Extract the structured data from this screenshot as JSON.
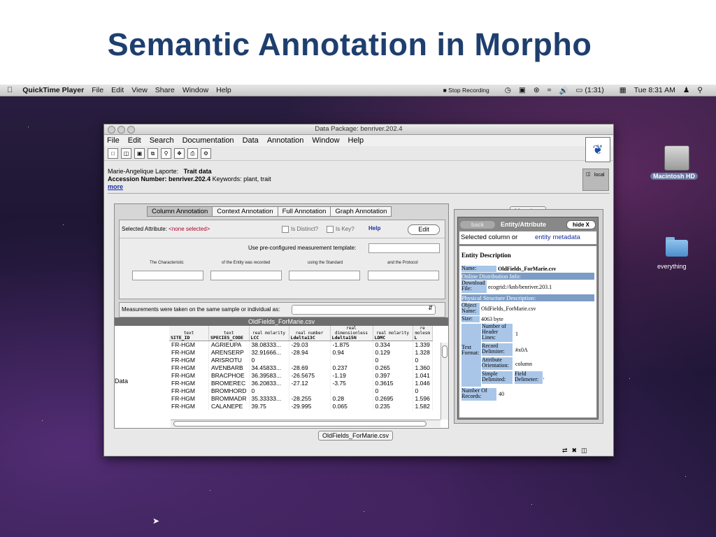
{
  "slide": {
    "title": "Semantic Annotation in Morpho"
  },
  "menubar": {
    "app": "QuickTime Player",
    "items": [
      "File",
      "Edit",
      "View",
      "Share",
      "Window",
      "Help"
    ],
    "right": {
      "record": "Stop Recording",
      "battery": "(1:31)",
      "clock": "Tue 8:31 AM"
    }
  },
  "desktop": {
    "disk_label": "Macintosh HD",
    "folder_label": "everything"
  },
  "window": {
    "title": "Data Package: benriver.202.4",
    "menu": [
      "File",
      "Edit",
      "Search",
      "Documentation",
      "Data",
      "Annotation",
      "Window",
      "Help"
    ],
    "info": {
      "owner": "Marie-Angelique Laporte:",
      "dataset": "Trait data",
      "accession_label": "Accession Number:",
      "accession": "benriver.202.4",
      "keywords_label": "Keywords:",
      "keywords": "plant, trait",
      "more": "more"
    },
    "local": "local",
    "tabs": [
      "Column Annotation",
      "Context Annotation",
      "Full Annotation",
      "Graph Annotation"
    ],
    "annotation": {
      "selected_label": "Selected Attribute:",
      "selected_value": "<none selected>",
      "is_distinct": "Is Distinct?",
      "is_key": "Is Key?",
      "help": "Help",
      "edit": "Edit",
      "template_label": "Use pre-configured measurement template:",
      "col_headers": [
        "The Characteristic",
        "of the Entity was recorded",
        "using the Standard",
        "and the Protocol"
      ],
      "measurements_label": "Measurements were taken on the same sample or individual as:"
    },
    "csv_title": "OldFields_ForMarie.csv",
    "data_label": "Data",
    "table": {
      "headers": [
        {
          "type": "text",
          "name": "SITE_ID"
        },
        {
          "type": "text",
          "name": "SPECIES_CODE"
        },
        {
          "type": "real molarity",
          "name": "LCC"
        },
        {
          "type": "real number",
          "name": "Ldelta13C"
        },
        {
          "type": "real dimensionless",
          "name": "Ldelta15N"
        },
        {
          "type": "real molarity",
          "name": "LDMC"
        },
        {
          "type": "re molesm",
          "name": "L"
        }
      ],
      "rows": [
        [
          "FR-HGM",
          "AGRIEUPA",
          "38.08333...",
          "-29.03",
          "-1.875",
          "0.334",
          "1.339"
        ],
        [
          "FR-HGM",
          "ARENSERP",
          "32.91666...",
          "-28.94",
          "0.94",
          "0.129",
          "1.328"
        ],
        [
          "FR-HGM",
          "ARISROTU",
          "0",
          "",
          "",
          "0",
          "0"
        ],
        [
          "FR-HGM",
          "AVENBARB",
          "34.45833...",
          "-28.69",
          "0.237",
          "0.265",
          "1.360"
        ],
        [
          "FR-HGM",
          "BRACPHOE",
          "36.39583...",
          "-26.5675",
          "-1.19",
          "0.397",
          "1.041"
        ],
        [
          "FR-HGM",
          "BROMEREC",
          "36.20833...",
          "-27.12",
          "-3.75",
          "0.3615",
          "1.046"
        ],
        [
          "FR-HGM",
          "BROMHORD",
          "0",
          "",
          "",
          "0",
          "0"
        ],
        [
          "FR-HGM",
          "BROMMADR",
          "35.33333...",
          "-28.255",
          "0.28",
          "0.2695",
          "1.596"
        ],
        [
          "FR-HGM",
          "CALANEPE",
          "39.75",
          "-29.995",
          "0.065",
          "0.235",
          "1.582"
        ]
      ]
    },
    "metadata": {
      "tab": "Metadata",
      "back": "back",
      "title": "Entity/Attribute",
      "hide": "hide X",
      "selected_col": "Selected column or",
      "entity_link": "entity metadata",
      "heading": "Entity Description",
      "name_label": "Name:",
      "name": "OldFields_ForMarie.csv",
      "online": "Online Distribution Info:",
      "download_label": "Download File:",
      "download": "ecogrid://knb/benriver.203.1",
      "physical": "Physical Structure Description:",
      "object_label": "Object Name:",
      "object": "OldFields_ForMarie.csv",
      "size_label": "Size:",
      "size": "4063 byte",
      "text_format": "Text Format:",
      "header_lines_label": "Number of Header Lines:",
      "header_lines": "1",
      "record_delim_label": "Record Delimiter:",
      "record_delim": "#x0A",
      "orientation_label": "Attribute Orientation:",
      "orientation": "column",
      "simple_label": "Simple Delimited:",
      "field_delim_label": "Field Delimeter:",
      "field_delim": "'",
      "records_label": "Number Of Records:",
      "records": "40"
    },
    "bottom_tab": "OldFields_ForMarie.csv"
  }
}
